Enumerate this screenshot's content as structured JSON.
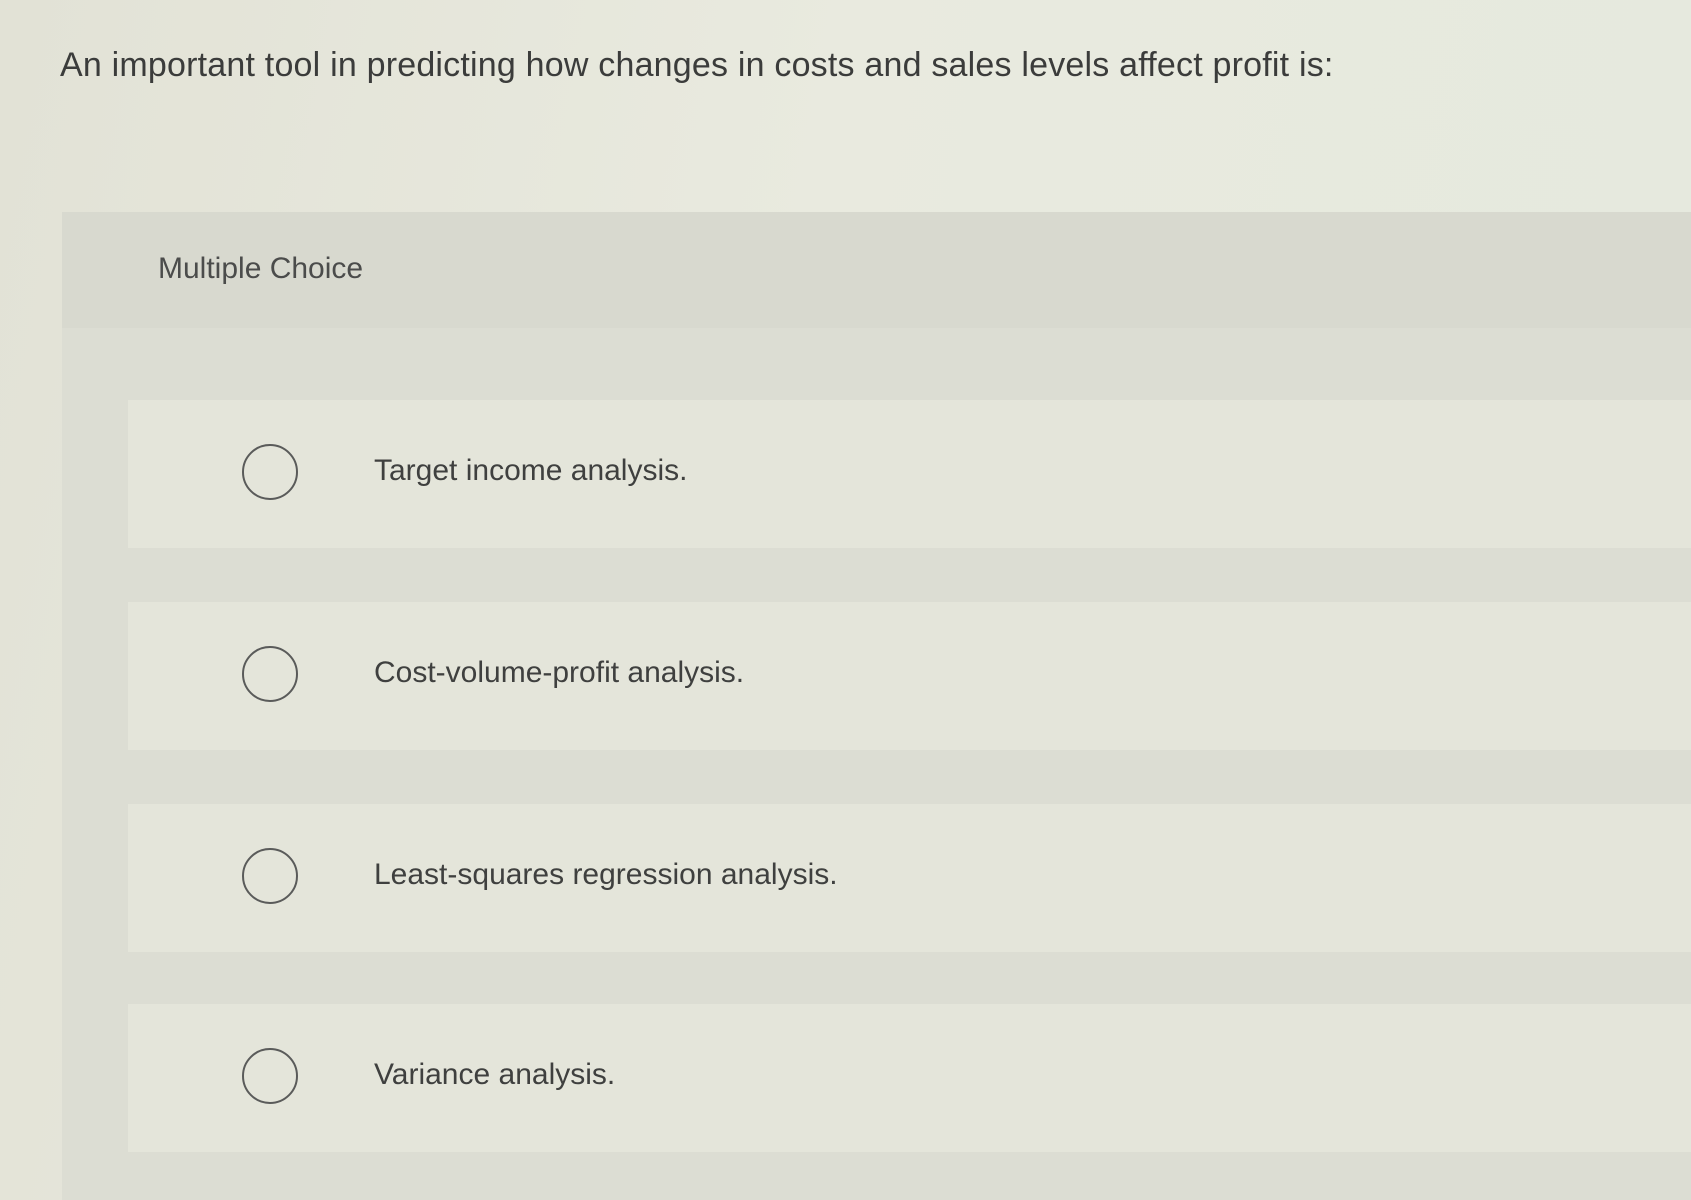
{
  "question": {
    "text": "An important tool in predicting how changes in costs and sales levels affect profit is:"
  },
  "multiple_choice": {
    "label": "Multiple Choice",
    "options": [
      {
        "label": "Target income analysis.",
        "selected": false
      },
      {
        "label": "Cost-volume-profit analysis.",
        "selected": false
      },
      {
        "label": "Least-squares regression analysis.",
        "selected": false
      },
      {
        "label": "Variance analysis.",
        "selected": false
      }
    ]
  },
  "colors": {
    "background": "#e6e7dc",
    "panel": "#dcddd3",
    "option_card": "#e4e5da",
    "text": "#3b3c3b"
  }
}
